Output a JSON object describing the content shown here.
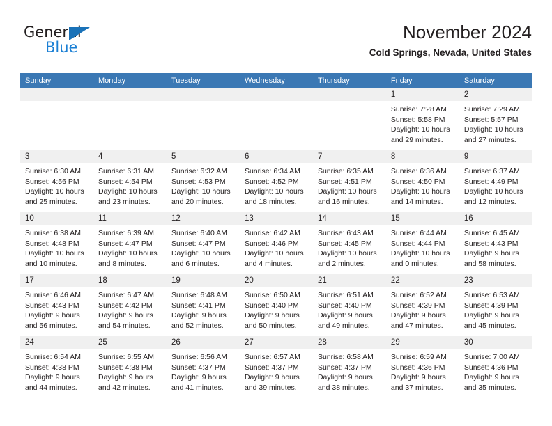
{
  "logo": {
    "word_top": "General",
    "word_bottom": "Blue",
    "triangle_color": "#1a72b8",
    "blue_color": "#1a7fd4"
  },
  "header": {
    "title": "November 2024",
    "location": "Cold Springs, Nevada, United States"
  },
  "theme": {
    "header_blue": "#3b78b4",
    "daynum_band": "#f0f0f0",
    "text": "#231f20"
  },
  "labels": {
    "sunrise_prefix": "Sunrise:",
    "sunset_prefix": "Sunset:",
    "daylight_prefix": "Daylight:"
  },
  "weekdays": [
    "Sunday",
    "Monday",
    "Tuesday",
    "Wednesday",
    "Thursday",
    "Friday",
    "Saturday"
  ],
  "weeks": [
    [
      {
        "day": "",
        "sunrise": "",
        "sunset": "",
        "daylight": "",
        "empty": true
      },
      {
        "day": "",
        "sunrise": "",
        "sunset": "",
        "daylight": "",
        "empty": true
      },
      {
        "day": "",
        "sunrise": "",
        "sunset": "",
        "daylight": "",
        "empty": true
      },
      {
        "day": "",
        "sunrise": "",
        "sunset": "",
        "daylight": "",
        "empty": true
      },
      {
        "day": "",
        "sunrise": "",
        "sunset": "",
        "daylight": "",
        "empty": true
      },
      {
        "day": "1",
        "sunrise": "Sunrise: 7:28 AM",
        "sunset": "Sunset: 5:58 PM",
        "daylight": "Daylight: 10 hours and 29 minutes.",
        "empty": false
      },
      {
        "day": "2",
        "sunrise": "Sunrise: 7:29 AM",
        "sunset": "Sunset: 5:57 PM",
        "daylight": "Daylight: 10 hours and 27 minutes.",
        "empty": false
      }
    ],
    [
      {
        "day": "3",
        "sunrise": "Sunrise: 6:30 AM",
        "sunset": "Sunset: 4:56 PM",
        "daylight": "Daylight: 10 hours and 25 minutes.",
        "empty": false
      },
      {
        "day": "4",
        "sunrise": "Sunrise: 6:31 AM",
        "sunset": "Sunset: 4:54 PM",
        "daylight": "Daylight: 10 hours and 23 minutes.",
        "empty": false
      },
      {
        "day": "5",
        "sunrise": "Sunrise: 6:32 AM",
        "sunset": "Sunset: 4:53 PM",
        "daylight": "Daylight: 10 hours and 20 minutes.",
        "empty": false
      },
      {
        "day": "6",
        "sunrise": "Sunrise: 6:34 AM",
        "sunset": "Sunset: 4:52 PM",
        "daylight": "Daylight: 10 hours and 18 minutes.",
        "empty": false
      },
      {
        "day": "7",
        "sunrise": "Sunrise: 6:35 AM",
        "sunset": "Sunset: 4:51 PM",
        "daylight": "Daylight: 10 hours and 16 minutes.",
        "empty": false
      },
      {
        "day": "8",
        "sunrise": "Sunrise: 6:36 AM",
        "sunset": "Sunset: 4:50 PM",
        "daylight": "Daylight: 10 hours and 14 minutes.",
        "empty": false
      },
      {
        "day": "9",
        "sunrise": "Sunrise: 6:37 AM",
        "sunset": "Sunset: 4:49 PM",
        "daylight": "Daylight: 10 hours and 12 minutes.",
        "empty": false
      }
    ],
    [
      {
        "day": "10",
        "sunrise": "Sunrise: 6:38 AM",
        "sunset": "Sunset: 4:48 PM",
        "daylight": "Daylight: 10 hours and 10 minutes.",
        "empty": false
      },
      {
        "day": "11",
        "sunrise": "Sunrise: 6:39 AM",
        "sunset": "Sunset: 4:47 PM",
        "daylight": "Daylight: 10 hours and 8 minutes.",
        "empty": false
      },
      {
        "day": "12",
        "sunrise": "Sunrise: 6:40 AM",
        "sunset": "Sunset: 4:47 PM",
        "daylight": "Daylight: 10 hours and 6 minutes.",
        "empty": false
      },
      {
        "day": "13",
        "sunrise": "Sunrise: 6:42 AM",
        "sunset": "Sunset: 4:46 PM",
        "daylight": "Daylight: 10 hours and 4 minutes.",
        "empty": false
      },
      {
        "day": "14",
        "sunrise": "Sunrise: 6:43 AM",
        "sunset": "Sunset: 4:45 PM",
        "daylight": "Daylight: 10 hours and 2 minutes.",
        "empty": false
      },
      {
        "day": "15",
        "sunrise": "Sunrise: 6:44 AM",
        "sunset": "Sunset: 4:44 PM",
        "daylight": "Daylight: 10 hours and 0 minutes.",
        "empty": false
      },
      {
        "day": "16",
        "sunrise": "Sunrise: 6:45 AM",
        "sunset": "Sunset: 4:43 PM",
        "daylight": "Daylight: 9 hours and 58 minutes.",
        "empty": false
      }
    ],
    [
      {
        "day": "17",
        "sunrise": "Sunrise: 6:46 AM",
        "sunset": "Sunset: 4:43 PM",
        "daylight": "Daylight: 9 hours and 56 minutes.",
        "empty": false
      },
      {
        "day": "18",
        "sunrise": "Sunrise: 6:47 AM",
        "sunset": "Sunset: 4:42 PM",
        "daylight": "Daylight: 9 hours and 54 minutes.",
        "empty": false
      },
      {
        "day": "19",
        "sunrise": "Sunrise: 6:48 AM",
        "sunset": "Sunset: 4:41 PM",
        "daylight": "Daylight: 9 hours and 52 minutes.",
        "empty": false
      },
      {
        "day": "20",
        "sunrise": "Sunrise: 6:50 AM",
        "sunset": "Sunset: 4:40 PM",
        "daylight": "Daylight: 9 hours and 50 minutes.",
        "empty": false
      },
      {
        "day": "21",
        "sunrise": "Sunrise: 6:51 AM",
        "sunset": "Sunset: 4:40 PM",
        "daylight": "Daylight: 9 hours and 49 minutes.",
        "empty": false
      },
      {
        "day": "22",
        "sunrise": "Sunrise: 6:52 AM",
        "sunset": "Sunset: 4:39 PM",
        "daylight": "Daylight: 9 hours and 47 minutes.",
        "empty": false
      },
      {
        "day": "23",
        "sunrise": "Sunrise: 6:53 AM",
        "sunset": "Sunset: 4:39 PM",
        "daylight": "Daylight: 9 hours and 45 minutes.",
        "empty": false
      }
    ],
    [
      {
        "day": "24",
        "sunrise": "Sunrise: 6:54 AM",
        "sunset": "Sunset: 4:38 PM",
        "daylight": "Daylight: 9 hours and 44 minutes.",
        "empty": false
      },
      {
        "day": "25",
        "sunrise": "Sunrise: 6:55 AM",
        "sunset": "Sunset: 4:38 PM",
        "daylight": "Daylight: 9 hours and 42 minutes.",
        "empty": false
      },
      {
        "day": "26",
        "sunrise": "Sunrise: 6:56 AM",
        "sunset": "Sunset: 4:37 PM",
        "daylight": "Daylight: 9 hours and 41 minutes.",
        "empty": false
      },
      {
        "day": "27",
        "sunrise": "Sunrise: 6:57 AM",
        "sunset": "Sunset: 4:37 PM",
        "daylight": "Daylight: 9 hours and 39 minutes.",
        "empty": false
      },
      {
        "day": "28",
        "sunrise": "Sunrise: 6:58 AM",
        "sunset": "Sunset: 4:37 PM",
        "daylight": "Daylight: 9 hours and 38 minutes.",
        "empty": false
      },
      {
        "day": "29",
        "sunrise": "Sunrise: 6:59 AM",
        "sunset": "Sunset: 4:36 PM",
        "daylight": "Daylight: 9 hours and 37 minutes.",
        "empty": false
      },
      {
        "day": "30",
        "sunrise": "Sunrise: 7:00 AM",
        "sunset": "Sunset: 4:36 PM",
        "daylight": "Daylight: 9 hours and 35 minutes.",
        "empty": false
      }
    ]
  ]
}
